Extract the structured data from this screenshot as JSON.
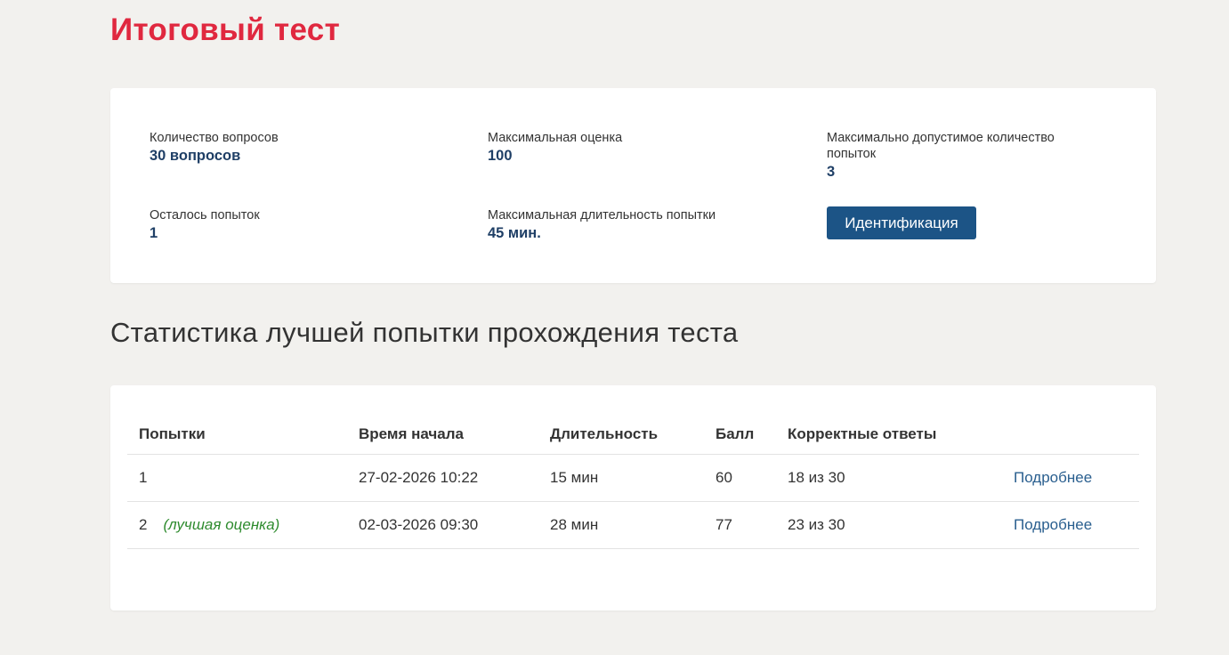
{
  "page": {
    "title": "Итоговый тест"
  },
  "info": {
    "questions_label": "Количество вопросов",
    "questions_value": "30 вопросов",
    "max_score_label": "Максимальная оценка",
    "max_score_value": "100",
    "max_attempts_label": "Максимально допустимое количество попыток",
    "max_attempts_value": "3",
    "remaining_label": "Осталось попыток",
    "remaining_value": "1",
    "max_duration_label": "Максимальная длительность попытки",
    "max_duration_value": "45 мин.",
    "identify_button": "Идентификация"
  },
  "stats": {
    "title": "Статистика лучшей попытки прохождения теста",
    "columns": [
      "Попытки",
      "Время начала",
      "Длительность",
      "Балл",
      "Корректные ответы",
      ""
    ],
    "rows": [
      {
        "attempt": "1",
        "note": "",
        "start": "27-02-2026 10:22",
        "duration": "15 мин",
        "score": "60",
        "correct": "18 из 30",
        "link": "Подробнее"
      },
      {
        "attempt": "2",
        "note": "(лучшая оценка)",
        "start": "02-03-2026 09:30",
        "duration": "28 мин",
        "score": "77",
        "correct": "23 из 30",
        "link": "Подробнее"
      }
    ]
  },
  "colors": {
    "title": "#e0283f",
    "value": "#1f3f66",
    "button": "#1c5486",
    "link": "#2a5f8f",
    "best_note": "#2e8b2e",
    "background": "#f2f1ee"
  }
}
